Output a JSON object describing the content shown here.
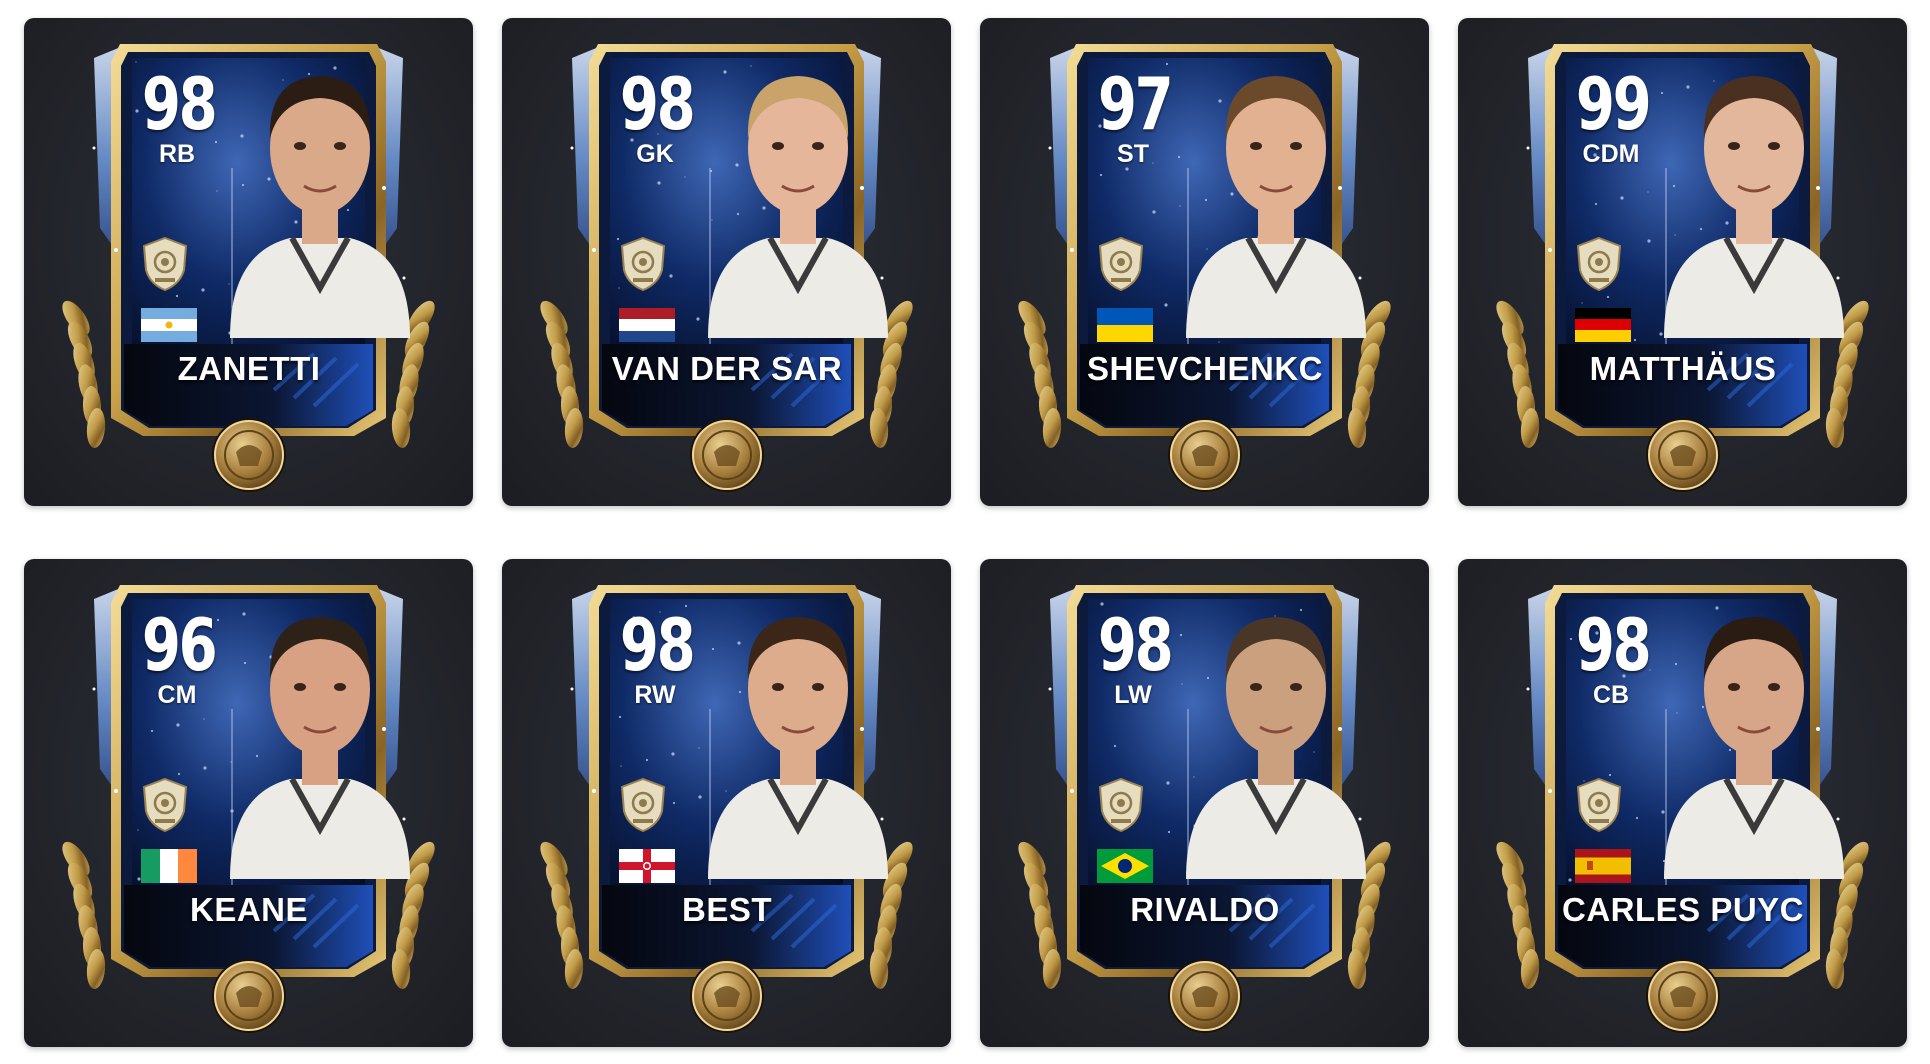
{
  "colors": {
    "tile_bg": "#24262d",
    "card_blue": "#0f2a66",
    "frame_gold": "#caa24a",
    "crystal_blue": "#6f97d6",
    "name_text": "#ffffff"
  },
  "cards": [
    {
      "rating": "98",
      "position": "RB",
      "name": "ZANETTI",
      "flag": "argentina"
    },
    {
      "rating": "98",
      "position": "GK",
      "name": "VAN DER SAR",
      "flag": "netherlands"
    },
    {
      "rating": "97",
      "position": "ST",
      "name": "SHEVCHENKC",
      "flag": "ukraine"
    },
    {
      "rating": "99",
      "position": "CDM",
      "name": "MATTHÄUS",
      "flag": "germany"
    },
    {
      "rating": "96",
      "position": "CM",
      "name": "KEANE",
      "flag": "ireland"
    },
    {
      "rating": "98",
      "position": "RW",
      "name": "BEST",
      "flag": "northern-ireland"
    },
    {
      "rating": "98",
      "position": "LW",
      "name": "RIVALDO",
      "flag": "brazil"
    },
    {
      "rating": "98",
      "position": "CB",
      "name": "CARLES PUYC",
      "flag": "spain"
    }
  ]
}
